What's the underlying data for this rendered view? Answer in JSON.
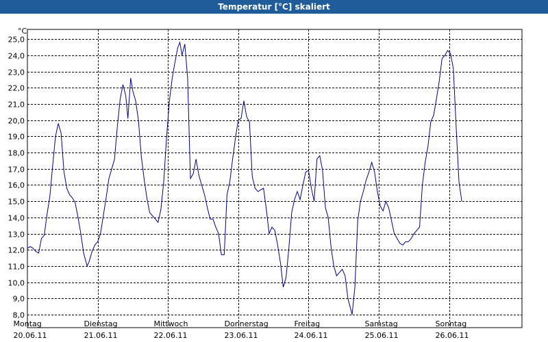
{
  "window": {
    "title": "Temperatur [°C] skaliert"
  },
  "chart_data": {
    "type": "line",
    "unit_label": "°C",
    "grid": true,
    "line_color": "#00008b",
    "ylim": [
      7.2,
      25.6
    ],
    "y_ticks": [
      8.0,
      9.0,
      10.0,
      11.0,
      12.0,
      13.0,
      14.0,
      15.0,
      16.0,
      17.0,
      18.0,
      19.0,
      20.0,
      21.0,
      22.0,
      23.0,
      24.0,
      25.0
    ],
    "y_tick_labels": [
      "8,0",
      "9,0",
      "10,0",
      "11,0",
      "12,0",
      "13,0",
      "14,0",
      "15,0",
      "16,0",
      "17,0",
      "18,0",
      "19,0",
      "20,0",
      "21,0",
      "22,0",
      "23,0",
      "24,0",
      "25,0"
    ],
    "xlim": [
      0,
      6.9
    ],
    "x_ticks": [
      0,
      1,
      2,
      3,
      4,
      5,
      6
    ],
    "x_tick_labels": [
      {
        "day": "Montag",
        "date": "20.06.11"
      },
      {
        "day": "Dienstag",
        "date": "21.06.11"
      },
      {
        "day": "Mittwoch",
        "date": "22.06.11"
      },
      {
        "day": "Donnerstag",
        "date": "23.06.11"
      },
      {
        "day": "Freitag",
        "date": "24.06.11"
      },
      {
        "day": "Samstag",
        "date": "25.06.11"
      },
      {
        "day": "Sonntag",
        "date": "26.06.11"
      }
    ],
    "series": [
      {
        "points": [
          [
            0.0,
            12.1
          ],
          [
            0.04,
            12.2
          ],
          [
            0.08,
            12.1
          ],
          [
            0.12,
            11.9
          ],
          [
            0.16,
            11.8
          ],
          [
            0.2,
            12.7
          ],
          [
            0.24,
            12.9
          ],
          [
            0.28,
            14.2
          ],
          [
            0.32,
            15.3
          ],
          [
            0.36,
            17.2
          ],
          [
            0.4,
            19.0
          ],
          [
            0.44,
            19.8
          ],
          [
            0.48,
            19.2
          ],
          [
            0.52,
            16.8
          ],
          [
            0.56,
            15.8
          ],
          [
            0.6,
            15.4
          ],
          [
            0.64,
            15.2
          ],
          [
            0.68,
            14.9
          ],
          [
            0.72,
            14.0
          ],
          [
            0.76,
            13.0
          ],
          [
            0.8,
            11.8
          ],
          [
            0.85,
            11.0
          ],
          [
            0.88,
            11.3
          ],
          [
            0.92,
            11.9
          ],
          [
            0.96,
            12.3
          ],
          [
            1.0,
            12.5
          ],
          [
            1.04,
            13.0
          ],
          [
            1.08,
            14.1
          ],
          [
            1.12,
            15.2
          ],
          [
            1.16,
            16.4
          ],
          [
            1.2,
            17.0
          ],
          [
            1.24,
            17.6
          ],
          [
            1.28,
            19.6
          ],
          [
            1.32,
            21.3
          ],
          [
            1.36,
            22.2
          ],
          [
            1.4,
            21.5
          ],
          [
            1.43,
            20.1
          ],
          [
            1.47,
            22.6
          ],
          [
            1.5,
            21.8
          ],
          [
            1.54,
            21.2
          ],
          [
            1.58,
            20.0
          ],
          [
            1.62,
            17.8
          ],
          [
            1.66,
            16.4
          ],
          [
            1.7,
            15.2
          ],
          [
            1.74,
            14.3
          ],
          [
            1.78,
            14.1
          ],
          [
            1.82,
            13.9
          ],
          [
            1.86,
            13.7
          ],
          [
            1.9,
            14.5
          ],
          [
            1.94,
            16.2
          ],
          [
            1.98,
            18.9
          ],
          [
            2.02,
            21.2
          ],
          [
            2.06,
            22.6
          ],
          [
            2.1,
            23.6
          ],
          [
            2.14,
            24.5
          ],
          [
            2.17,
            24.8
          ],
          [
            2.2,
            24.0
          ],
          [
            2.24,
            24.7
          ],
          [
            2.28,
            22.6
          ],
          [
            2.32,
            16.4
          ],
          [
            2.36,
            16.7
          ],
          [
            2.4,
            17.6
          ],
          [
            2.44,
            16.6
          ],
          [
            2.48,
            16.0
          ],
          [
            2.52,
            15.4
          ],
          [
            2.56,
            14.6
          ],
          [
            2.6,
            13.9
          ],
          [
            2.64,
            13.9
          ],
          [
            2.68,
            13.4
          ],
          [
            2.72,
            13.0
          ],
          [
            2.76,
            11.7
          ],
          [
            2.8,
            11.7
          ],
          [
            2.84,
            15.4
          ],
          [
            2.88,
            16.2
          ],
          [
            2.92,
            17.6
          ],
          [
            2.96,
            18.9
          ],
          [
            3.0,
            20.0
          ],
          [
            3.04,
            20.1
          ],
          [
            3.08,
            21.2
          ],
          [
            3.12,
            20.2
          ],
          [
            3.16,
            19.9
          ],
          [
            3.2,
            16.5
          ],
          [
            3.24,
            15.8
          ],
          [
            3.28,
            15.6
          ],
          [
            3.32,
            15.7
          ],
          [
            3.36,
            15.8
          ],
          [
            3.4,
            14.5
          ],
          [
            3.44,
            13.0
          ],
          [
            3.48,
            13.4
          ],
          [
            3.52,
            13.2
          ],
          [
            3.56,
            12.3
          ],
          [
            3.6,
            11.2
          ],
          [
            3.64,
            9.7
          ],
          [
            3.68,
            10.3
          ],
          [
            3.72,
            12.1
          ],
          [
            3.76,
            14.3
          ],
          [
            3.8,
            15.1
          ],
          [
            3.84,
            15.6
          ],
          [
            3.88,
            15.1
          ],
          [
            3.92,
            16.0
          ],
          [
            3.96,
            16.8
          ],
          [
            4.0,
            16.9
          ],
          [
            4.04,
            15.8
          ],
          [
            4.08,
            15.0
          ],
          [
            4.12,
            17.6
          ],
          [
            4.16,
            17.8
          ],
          [
            4.2,
            16.9
          ],
          [
            4.24,
            14.6
          ],
          [
            4.28,
            14.0
          ],
          [
            4.32,
            12.2
          ],
          [
            4.36,
            11.0
          ],
          [
            4.4,
            10.4
          ],
          [
            4.44,
            10.6
          ],
          [
            4.48,
            10.8
          ],
          [
            4.52,
            10.4
          ],
          [
            4.56,
            9.0
          ],
          [
            4.62,
            8.0
          ],
          [
            4.66,
            9.7
          ],
          [
            4.7,
            13.8
          ],
          [
            4.74,
            15.0
          ],
          [
            4.78,
            15.6
          ],
          [
            4.82,
            16.3
          ],
          [
            4.86,
            16.8
          ],
          [
            4.9,
            17.4
          ],
          [
            4.94,
            16.8
          ],
          [
            4.98,
            15.6
          ],
          [
            5.02,
            14.7
          ],
          [
            5.06,
            14.4
          ],
          [
            5.1,
            15.0
          ],
          [
            5.14,
            14.6
          ],
          [
            5.18,
            13.8
          ],
          [
            5.22,
            13.0
          ],
          [
            5.26,
            12.7
          ],
          [
            5.3,
            12.4
          ],
          [
            5.34,
            12.3
          ],
          [
            5.38,
            12.5
          ],
          [
            5.42,
            12.5
          ],
          [
            5.46,
            12.7
          ],
          [
            5.5,
            13.0
          ],
          [
            5.54,
            13.2
          ],
          [
            5.58,
            13.4
          ],
          [
            5.62,
            16.0
          ],
          [
            5.66,
            17.4
          ],
          [
            5.7,
            18.4
          ],
          [
            5.74,
            19.9
          ],
          [
            5.78,
            20.3
          ],
          [
            5.82,
            21.3
          ],
          [
            5.86,
            22.4
          ],
          [
            5.9,
            23.8
          ],
          [
            5.94,
            24.0
          ],
          [
            5.98,
            24.3
          ],
          [
            6.02,
            24.1
          ],
          [
            6.06,
            23.2
          ],
          [
            6.1,
            19.6
          ],
          [
            6.14,
            16.2
          ],
          [
            6.18,
            15.0
          ]
        ]
      }
    ]
  }
}
